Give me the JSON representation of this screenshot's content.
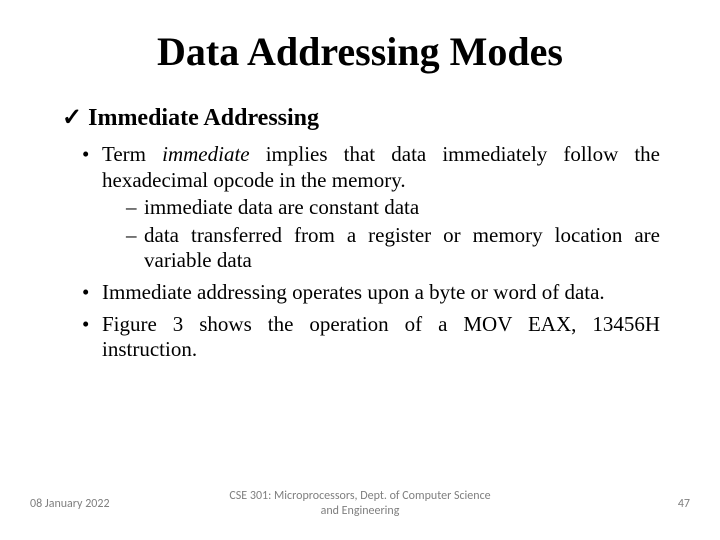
{
  "title": "Data Addressing Modes",
  "subheading": "Immediate Addressing",
  "bullet1_a": "Term ",
  "bullet1_italic": "immediate",
  "bullet1_b": " implies that data immediately follow the hexadecimal opcode in the memory.",
  "sub1": "immediate data are constant data",
  "sub2": "data transferred from a register or memory location are variable data",
  "bullet2": "Immediate addressing operates upon a byte or word of data.",
  "bullet3": "Figure 3 shows the operation of a MOV EAX, 13456H instruction.",
  "footer": {
    "date": "08 January 2022",
    "center": "CSE 301: Microprocessors, Dept. of Computer Science and Engineering",
    "page": "47"
  }
}
